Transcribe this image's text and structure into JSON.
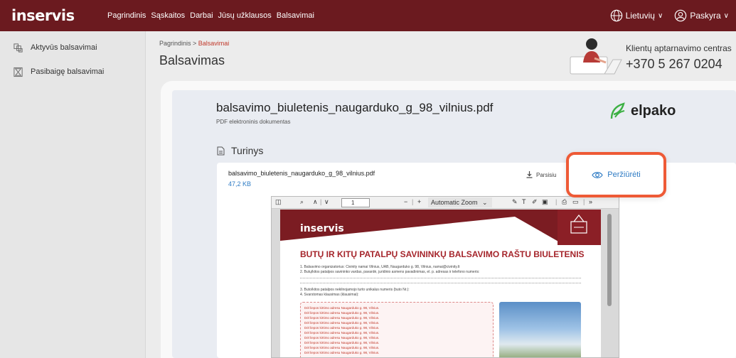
{
  "app": {
    "logo": "inservis"
  },
  "nav": [
    "Pagrindinis",
    "Sąskaitos",
    "Darbai",
    "Jūsų užklausos",
    "Balsavimai"
  ],
  "top_right": {
    "language": "Lietuvių",
    "account": "Paskyra"
  },
  "sidebar": {
    "items": [
      {
        "label": "Aktyvūs balsavimai",
        "icon": "ballot-icon"
      },
      {
        "label": "Pasibaigę balsavimai",
        "icon": "hourglass-icon"
      }
    ]
  },
  "breadcrumb": {
    "home": "Pagrindinis",
    "sep": " > ",
    "current": "Balsavimai"
  },
  "page_title": "Balsavimas",
  "support": {
    "label": "Klientų aptarnavimo centras",
    "phone": "+370 5 267 0204"
  },
  "document": {
    "file_name": "balsavimo_biuletenis_naugarduko_g_98_vilnius.pdf",
    "file_type": "PDF elektroninis dokumentas",
    "provider": "elpako",
    "section": "Turinys",
    "card_name": "balsavimo_biuletenis_naugarduko_g_98_vilnius.pdf",
    "card_size": "47,2 KB",
    "download_label": "Parsisiu",
    "preview_label": "Peržiūrėti"
  },
  "viewer": {
    "page": "1",
    "zoom": "Automatic Zoom",
    "pdf_logo": "inservis",
    "pdf_title": "BUTŲ IR KITŲ PATALPŲ SAVININKŲ BALSAVIMO RAŠTU BIULETENIS",
    "line1": "1. Balsavimo organizatorius: Civinity namai Vilnius, UAB, Naugarduko g. 98, Vilnius, namai@civinity.lt",
    "line2": "2. Butų/kitos patalpos savininko vardas, pavardė, juridinio asmens pavadinimas, el. p. adresas ir telefono numeris:",
    "line3": "3. Buto/kitos patalpos nekilnojamojo turto unikalus numeris (buto Nr.):",
    "line4": "4. Svarstomas klausimas (klausimai):",
    "box_line": "Dėl liepos kirtimo adresu Naugarduko g. 98, Vilnius."
  },
  "colors": {
    "brand": "#6b1a1f",
    "accent": "#ee5a36",
    "link": "#2e7bc4"
  }
}
